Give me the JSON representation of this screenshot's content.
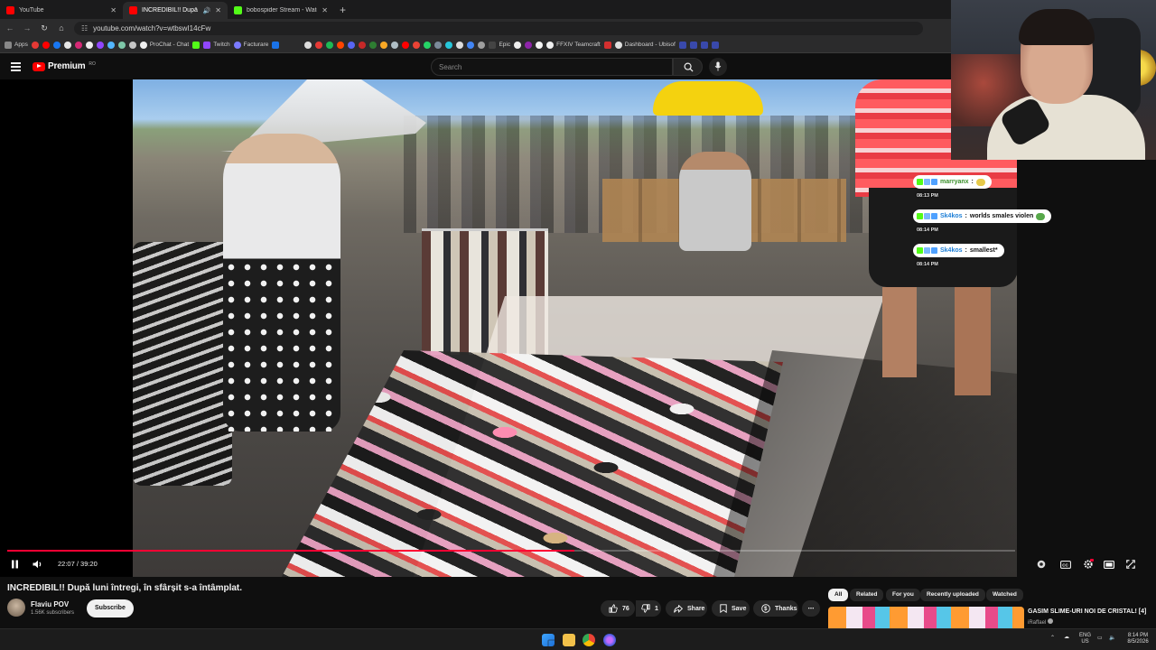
{
  "browser": {
    "tabs": [
      {
        "title": "YouTube",
        "color": "#ff0000",
        "active": false
      },
      {
        "title": "INCREDIBIL!! După luni într",
        "color": "#ff0000",
        "active": true
      },
      {
        "title": "bobospider Stream - Watch Li",
        "color": "#53fc18",
        "active": false
      }
    ],
    "url": "youtube.com/watch?v=wtbswI14cFw",
    "bookmarks": [
      "Apps",
      "ProChat - Chat",
      "Twitch",
      "Facturare",
      "Epic",
      "FFXIV Teamcraft",
      "Dashboard - Ubisof"
    ]
  },
  "youtube": {
    "brand": "Premium",
    "brand_badge": "RO",
    "search_placeholder": "Search"
  },
  "chat": [
    {
      "user": "marryanx",
      "message": "",
      "time": "08:13 PM"
    },
    {
      "user": "Sk4kos",
      "message": "worlds smales violen",
      "time": "08:14 PM"
    },
    {
      "user": "Sk4kos",
      "message": "smallest*",
      "time": "08:14 PM"
    }
  ],
  "player": {
    "time_current": "22:07",
    "time_total": "39:20",
    "progress": 0.5623
  },
  "video": {
    "title": "INCREDIBIL!! După luni întregi, în sfârșit s-a întâmplat.",
    "channel": "Flaviu POV",
    "subscribers": "1.56K subscribers",
    "subscribe_label": "Subscribe",
    "likes": "76",
    "dislikes": "1",
    "share_label": "Share",
    "save_label": "Save",
    "thanks_label": "Thanks"
  },
  "chips": [
    "All",
    "Related",
    "For you",
    "Recently uploaded",
    "Watched"
  ],
  "recommendation": {
    "title": "GASIM SLIME-URI NOI DE CRISTAL! [4]",
    "channel": "iRaffael"
  },
  "taskbar": {
    "lang_top": "ENG",
    "lang_bottom": "US",
    "time": "8:14 PM",
    "date": "8/5/2026"
  }
}
